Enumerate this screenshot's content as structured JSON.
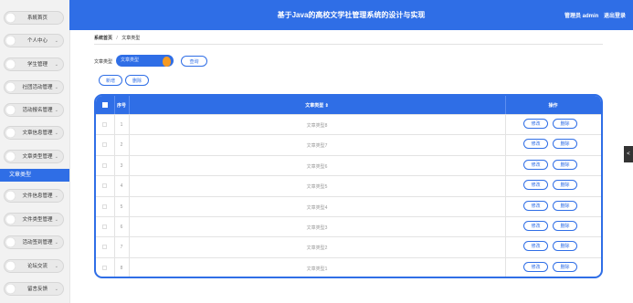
{
  "sidebar": {
    "items": [
      {
        "label": "系統首页",
        "has_chevron": false
      },
      {
        "label": "个人中心",
        "has_chevron": true
      },
      {
        "label": "学生管理",
        "has_chevron": true
      },
      {
        "label": "社团活动管理",
        "has_chevron": true
      },
      {
        "label": "活动报名管理",
        "has_chevron": true
      },
      {
        "label": "文章信息管理",
        "has_chevron": true
      },
      {
        "label": "文章类型管理",
        "has_chevron": true
      }
    ],
    "active_item": "文章类型",
    "items_after": [
      {
        "label": "文件信息管理",
        "has_chevron": true
      },
      {
        "label": "文件类型管理",
        "has_chevron": true
      },
      {
        "label": "活动签到管理",
        "has_chevron": true
      },
      {
        "label": "论坛交流",
        "has_chevron": true
      },
      {
        "label": "留言反馈",
        "has_chevron": true
      }
    ]
  },
  "header": {
    "title": "基于Java的高校文学社管理系统的设计与实现",
    "user": "管理员 admin",
    "logout": "退出登录",
    "color": "#2f6ee6"
  },
  "breadcrumb": {
    "home": "系统首页",
    "separator": "/",
    "current": "文章类型"
  },
  "search": {
    "label": "文章类型",
    "placeholder": "文章类型",
    "button": "查询"
  },
  "actions": {
    "add": "新增",
    "delete": "删除"
  },
  "table": {
    "headers": {
      "seq": "序号",
      "type": "文章类型 ⇕",
      "ops": "操作"
    },
    "rows": [
      {
        "seq": "1",
        "type": "文章类型8"
      },
      {
        "seq": "2",
        "type": "文章类型7"
      },
      {
        "seq": "3",
        "type": "文章类型6"
      },
      {
        "seq": "4",
        "type": "文章类型5"
      },
      {
        "seq": "5",
        "type": "文章类型4"
      },
      {
        "seq": "6",
        "type": "文章类型3"
      },
      {
        "seq": "7",
        "type": "文章类型2"
      },
      {
        "seq": "8",
        "type": "文章类型1"
      }
    ],
    "row_edit": "修改",
    "row_delete": "删除"
  },
  "right_handle": "<"
}
